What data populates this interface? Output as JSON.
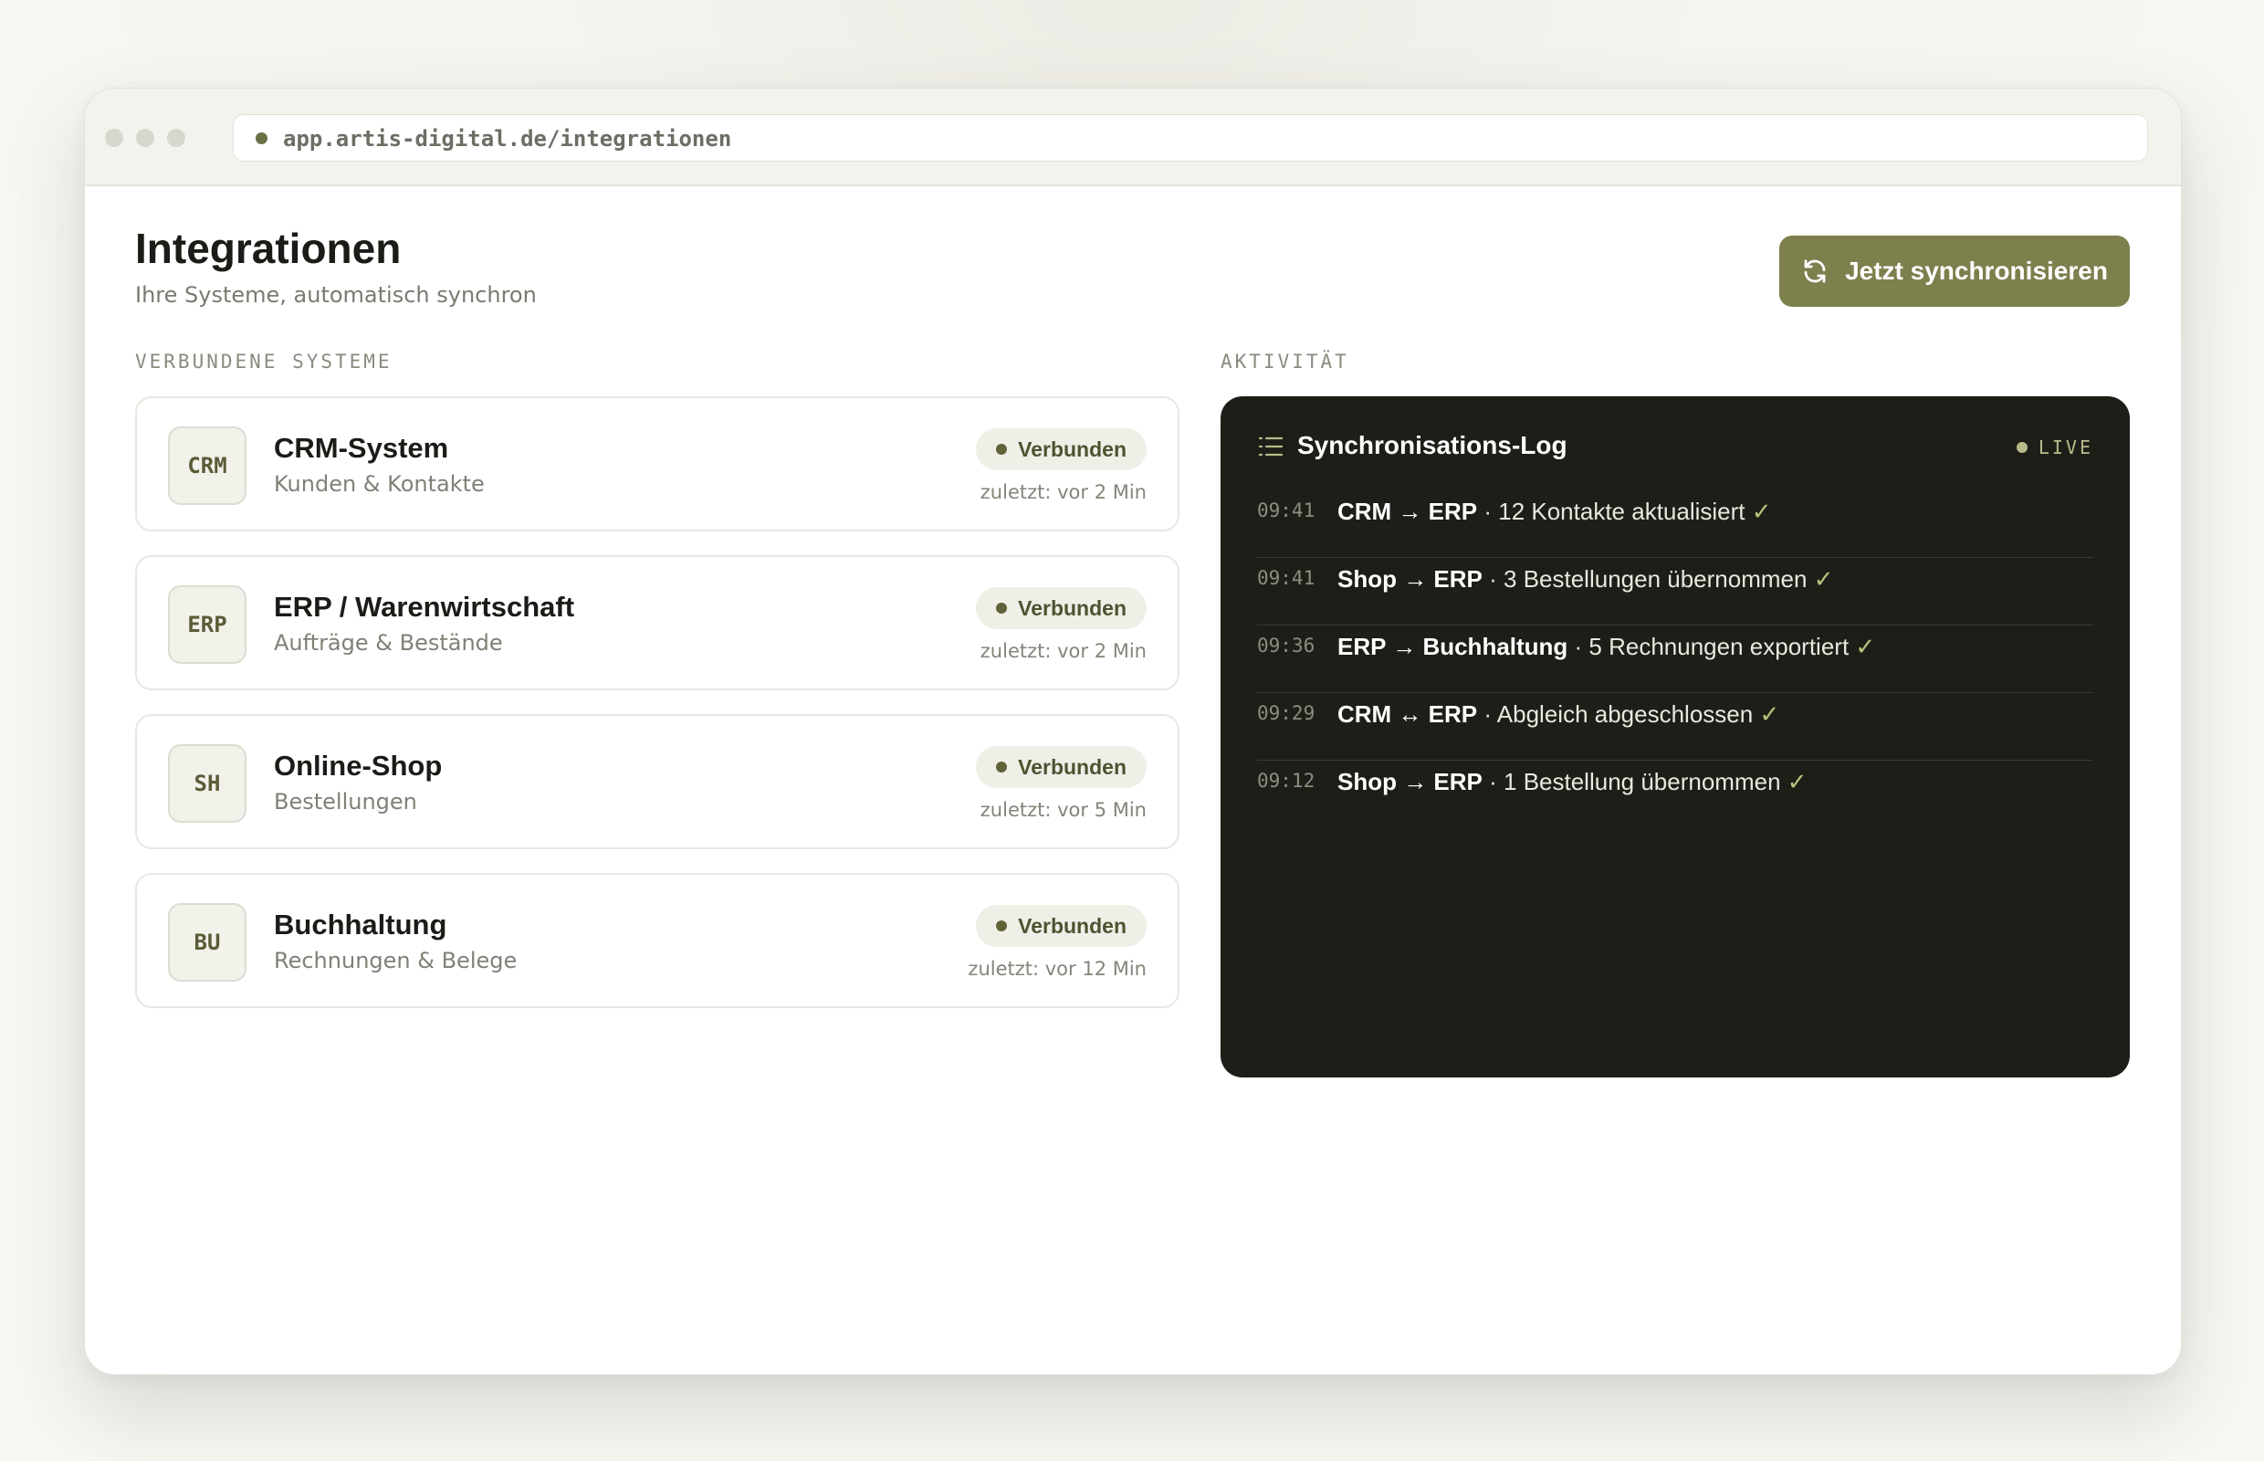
{
  "browser": {
    "url": "app.artis-digital.de/integrationen"
  },
  "header": {
    "title": "Integrationen",
    "subtitle": "Ihre Systeme, automatisch synchron",
    "sync_button_label": "Jetzt synchronisieren"
  },
  "connected_systems": {
    "section_label": "VERBUNDENE SYSTEME",
    "items": [
      {
        "badge": "CRM",
        "title": "CRM-System",
        "subtitle": "Kunden & Kontakte",
        "status": "Verbunden",
        "last_sync": "zuletzt: vor 2 Min"
      },
      {
        "badge": "ERP",
        "title": "ERP / Warenwirtschaft",
        "subtitle": "Aufträge & Bestände",
        "status": "Verbunden",
        "last_sync": "zuletzt: vor 2 Min"
      },
      {
        "badge": "SH",
        "title": "Online-Shop",
        "subtitle": "Bestellungen",
        "status": "Verbunden",
        "last_sync": "zuletzt: vor 5 Min"
      },
      {
        "badge": "BU",
        "title": "Buchhaltung",
        "subtitle": "Rechnungen & Belege",
        "status": "Verbunden",
        "last_sync": "zuletzt: vor 12 Min"
      }
    ]
  },
  "activity": {
    "section_label": "AKTIVITÄT",
    "log_title": "Synchronisations-Log",
    "live_label": "LIVE",
    "entries": [
      {
        "time": "09:41",
        "route": "CRM → ERP",
        "separator": " · ",
        "message": "12 Kontakte aktualisiert",
        "check": " ✓"
      },
      {
        "time": "09:41",
        "route": "Shop → ERP",
        "separator": " · ",
        "message": "3 Bestellungen übernommen",
        "check": " ✓"
      },
      {
        "time": "09:36",
        "route": "ERP → Buchhaltung",
        "separator": " · ",
        "message": "5 Rechnungen exportiert",
        "check": " ✓"
      },
      {
        "time": "09:29",
        "route": "CRM ↔ ERP",
        "separator": " · ",
        "message": "Abgleich abgeschlossen",
        "check": " ✓"
      },
      {
        "time": "09:12",
        "route": "Shop → ERP",
        "separator": " · ",
        "message": "1 Bestellung übernommen",
        "check": " ✓"
      }
    ]
  },
  "colors": {
    "accent": "#7d7f4d",
    "status_dot": "#606337",
    "log_background": "#1e1e19",
    "check": "#b7c37a"
  }
}
